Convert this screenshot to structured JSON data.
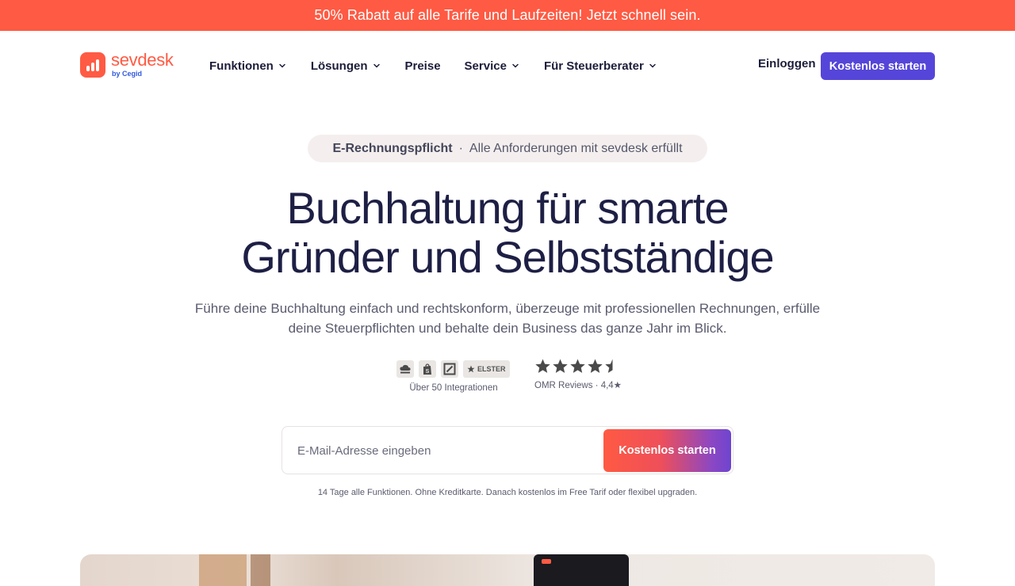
{
  "promo": {
    "text": "50% Rabatt auf alle Tarife und Laufzeiten! Jetzt schnell sein."
  },
  "header": {
    "logo": {
      "word": "sevdesk",
      "sub": "by Cegid"
    },
    "nav": [
      {
        "label": "Funktionen",
        "has_dropdown": true
      },
      {
        "label": "Lösungen",
        "has_dropdown": true
      },
      {
        "label": "Preise",
        "has_dropdown": false
      },
      {
        "label": "Service",
        "has_dropdown": true
      },
      {
        "label": "Für Steuerberater",
        "has_dropdown": true
      }
    ],
    "login_label": "Einloggen",
    "cta_label": "Kostenlos starten"
  },
  "hero": {
    "pill_strong": "E-Rechnungspflicht",
    "pill_separator": "·",
    "pill_text": "Alle Anforderungen mit sevdesk erfüllt",
    "title_line1": "Buchhaltung für smarte",
    "title_line2": "Gründer und Selbstständige",
    "subtitle_line1": "Führe deine Buchhaltung einfach und rechtskonform, überzeuge mit professionellen Rechnungen, erfülle",
    "subtitle_line2": "deine Steuerpflichten und behalte dein Business das ganze Jahr im Blick."
  },
  "trust": {
    "integrations": {
      "icons": [
        "datev-cloud-icon",
        "shopify-icon",
        "deutsche-bank-icon",
        "elster-icon"
      ],
      "elster_label": "ELSTER",
      "label": "Über 50 Integrationen"
    },
    "reviews": {
      "rating": 4.4,
      "max": 5,
      "label": "OMR Reviews · 4,4★"
    }
  },
  "signup": {
    "email_placeholder": "E-Mail-Adresse eingeben",
    "email_value": "",
    "cta_label": "Kostenlos starten",
    "fine_print": "14 Tage alle Funktionen. Ohne Kreditkarte. Danach kostenlos im Free Tarif oder flexibel upgraden."
  },
  "colors": {
    "brand_orange": "#ff5a43",
    "brand_purple": "#5546d9",
    "heading": "#1e1f45",
    "pill_bg": "#f4efee"
  }
}
